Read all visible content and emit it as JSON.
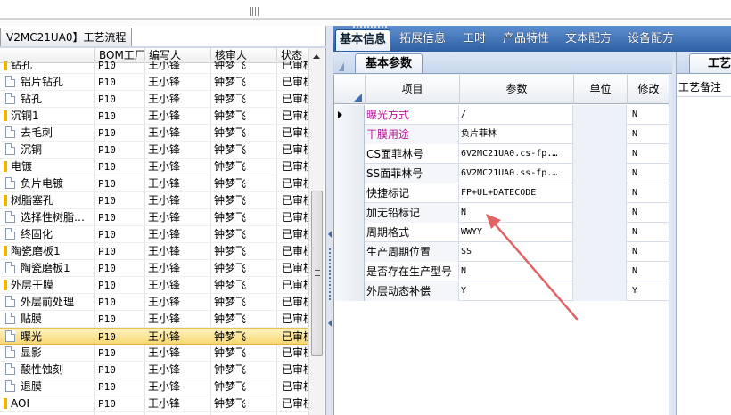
{
  "left_panel": {
    "tab_title": "V2MC21UA0】工艺流程",
    "columns": [
      "BOM工厂",
      "编写人",
      "核审人",
      "状态"
    ],
    "rows": [
      {
        "name": "钻孔",
        "type": "group",
        "bom": "P10",
        "writer": "王小锋",
        "checker": "钟梦飞",
        "status": "已审核"
      },
      {
        "name": "铝片钻孔",
        "type": "leaf",
        "bom": "P10",
        "writer": "王小锋",
        "checker": "钟梦飞",
        "status": "已审核"
      },
      {
        "name": "钻孔",
        "type": "leaf",
        "bom": "P10",
        "writer": "王小锋",
        "checker": "钟梦飞",
        "status": "已审核"
      },
      {
        "name": "沉铜1",
        "type": "group",
        "bom": "P10",
        "writer": "王小锋",
        "checker": "钟梦飞",
        "status": "已审核"
      },
      {
        "name": "去毛刺",
        "type": "leaf",
        "bom": "P10",
        "writer": "王小锋",
        "checker": "钟梦飞",
        "status": "已审核"
      },
      {
        "name": "沉铜",
        "type": "leaf",
        "bom": "P10",
        "writer": "王小锋",
        "checker": "钟梦飞",
        "status": "已审核"
      },
      {
        "name": "电镀",
        "type": "group",
        "bom": "P10",
        "writer": "王小锋",
        "checker": "钟梦飞",
        "status": "已审核"
      },
      {
        "name": "负片电镀",
        "type": "leaf",
        "bom": "P10",
        "writer": "王小锋",
        "checker": "钟梦飞",
        "status": "已审核"
      },
      {
        "name": "树脂塞孔",
        "type": "group",
        "bom": "P10",
        "writer": "王小锋",
        "checker": "钟梦飞",
        "status": "已审核"
      },
      {
        "name": "选择性树脂…",
        "type": "leaf",
        "bom": "P10",
        "writer": "王小锋",
        "checker": "钟梦飞",
        "status": "已审核"
      },
      {
        "name": "终固化",
        "type": "leaf",
        "bom": "P10",
        "writer": "王小锋",
        "checker": "钟梦飞",
        "status": "已审核"
      },
      {
        "name": "陶瓷磨板1",
        "type": "group",
        "bom": "P10",
        "writer": "王小锋",
        "checker": "钟梦飞",
        "status": "已审核"
      },
      {
        "name": "陶瓷磨板1",
        "type": "leaf",
        "bom": "P10",
        "writer": "王小锋",
        "checker": "钟梦飞",
        "status": "已审核"
      },
      {
        "name": "外层干膜",
        "type": "group",
        "bom": "P10",
        "writer": "王小锋",
        "checker": "钟梦飞",
        "status": "已审核"
      },
      {
        "name": "外层前处理",
        "type": "leaf",
        "bom": "P10",
        "writer": "王小锋",
        "checker": "钟梦飞",
        "status": "已审核"
      },
      {
        "name": "贴膜",
        "type": "leaf",
        "bom": "P10",
        "writer": "王小锋",
        "checker": "钟梦飞",
        "status": "已审核"
      },
      {
        "name": "曝光",
        "type": "leaf",
        "bom": "P10",
        "writer": "王小锋",
        "checker": "钟梦飞",
        "status": "已审核",
        "selected": true
      },
      {
        "name": "显影",
        "type": "leaf",
        "bom": "P10",
        "writer": "王小锋",
        "checker": "钟梦飞",
        "status": "已审核"
      },
      {
        "name": "酸性蚀刻",
        "type": "leaf",
        "bom": "P10",
        "writer": "王小锋",
        "checker": "钟梦飞",
        "status": "已审核"
      },
      {
        "name": "退膜",
        "type": "leaf",
        "bom": "P10",
        "writer": "王小锋",
        "checker": "钟梦飞",
        "status": "已审核"
      },
      {
        "name": "AOI",
        "type": "group",
        "bom": "P10",
        "writer": "王小锋",
        "checker": "钟梦飞",
        "status": "已审核"
      }
    ]
  },
  "tabs": [
    "基本信息",
    "拓展信息",
    "工时",
    "产品特性",
    "文本配方",
    "设备配方"
  ],
  "subtab": "基本参数",
  "grid": {
    "columns": [
      "项目",
      "参数",
      "单位",
      "修改"
    ],
    "rows": [
      {
        "item": "曝光方式",
        "param": "/",
        "unit": "",
        "mod": "N",
        "highlight": true,
        "current": true
      },
      {
        "item": "干膜用途",
        "param": "负片菲林",
        "unit": "",
        "mod": "N",
        "highlight": true
      },
      {
        "item": "CS面菲林号",
        "param": "6V2MC21UA0.cs-fp.…",
        "unit": "",
        "mod": "N"
      },
      {
        "item": "SS面菲林号",
        "param": "6V2MC21UA0.ss-fp.…",
        "unit": "",
        "mod": "N"
      },
      {
        "item": "快捷标记",
        "param": "FP+UL+DATECODE",
        "unit": "",
        "mod": "N"
      },
      {
        "item": "加无铅标记",
        "param": "N",
        "unit": "",
        "mod": "N"
      },
      {
        "item": "周期格式",
        "param": "WWYY",
        "unit": "",
        "mod": "N"
      },
      {
        "item": "生产周期位置",
        "param": "SS",
        "unit": "",
        "mod": "N"
      },
      {
        "item": "是否存在生产型号",
        "param": "N",
        "unit": "",
        "mod": "N"
      },
      {
        "item": "外层动态补偿",
        "param": "Y",
        "unit": "",
        "mod": "Y"
      }
    ]
  },
  "right_panel": {
    "tab": "工艺",
    "label": "工艺备注"
  },
  "colors": {
    "tab_strip": "#2e5fa3",
    "highlight_text": "#b6179a",
    "selection": "#f8d873",
    "annotation_arrow": "#e06464"
  }
}
